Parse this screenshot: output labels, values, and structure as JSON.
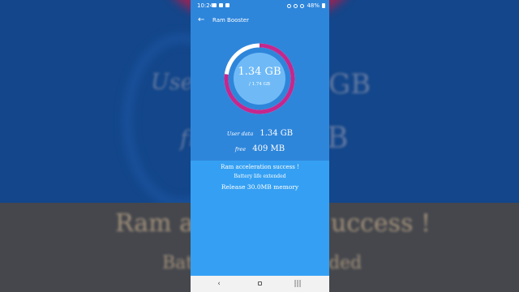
{
  "background": {
    "user_text": "User",
    "gb_text": "GB",
    "free_text": "fr",
    "b_text": "B",
    "ram_text": "Ram ac",
    "success_text": "uccess !",
    "battery_text": "Bat",
    "ded_text": "ded"
  },
  "status_bar": {
    "time": "10:24",
    "battery": "48%"
  },
  "app_bar": {
    "title": "Ram Booster"
  },
  "memory": {
    "used": "1.34 GB",
    "total": "/ 1.74 GB",
    "used_fraction": 0.77,
    "user_data_label": "User data",
    "user_data_value": "1.34 GB",
    "free_label": "free",
    "free_value": "409 MB"
  },
  "result": {
    "success": "Ram acceleration success !",
    "battery": "Battery life extended",
    "release": "Release 30.0MB memory"
  },
  "colors": {
    "header_blue": "#2e86db",
    "panel_blue": "#35a0f3",
    "ring_magenta": "#c4278d",
    "ring_white": "#ffffff"
  },
  "icons": {
    "back": "arrow-left-icon",
    "nav_back": "chevron-left-icon",
    "nav_home": "home-icon",
    "nav_recent": "recent-apps-icon"
  }
}
